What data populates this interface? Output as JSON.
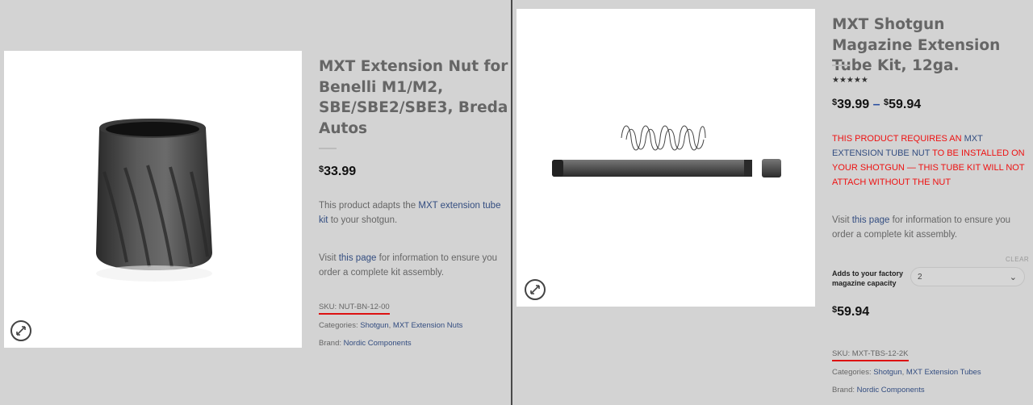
{
  "left_product": {
    "title": "MXT Extension Nut for Benelli M1/M2, SBE/SBE2/SBE3, Breda Autos",
    "price_currency": "$",
    "price_amount": "33.99",
    "desc_prefix": "This product adapts the ",
    "desc_link": "MXT extension tube kit",
    "desc_suffix": " to your shotgun.",
    "visit_prefix": "Visit ",
    "visit_link": "this page",
    "visit_suffix": " for information to ensure you order a complete kit assembly.",
    "sku_label": "SKU: NUT-BN-12-00",
    "categories_label": "Categories: ",
    "categories": [
      "Shotgun",
      "MXT Extension Nuts"
    ],
    "brand_label": "Brand: ",
    "brand": "Nordic Components",
    "image_icon": "zoom-expand-icon"
  },
  "right_product": {
    "title": "MXT Shotgun Magazine Extension Tube Kit, 12ga.",
    "rating": 5,
    "stars_text": "★★★★★",
    "price_low_currency": "$",
    "price_low": "39.99",
    "price_sep": "–",
    "price_high_currency": "$",
    "price_high": "59.94",
    "notice_prefix": "THIS PRODUCT REQUIRES AN ",
    "notice_link": "MXT EXTENSION TUBE NUT",
    "notice_suffix": " TO BE INSTALLED ON YOUR SHOTGUN — THIS TUBE KIT WILL NOT ATTACH WITHOUT THE NUT",
    "visit_prefix": "Visit ",
    "visit_link": "this page",
    "visit_suffix": " for information to ensure you order a complete kit assembly.",
    "clear_label": "CLEAR",
    "variation_label": "Adds to your factory magazine capacity",
    "variation_value": "2",
    "selected_price_currency": "$",
    "selected_price": "59.94",
    "sku_label": "SKU: MXT-TBS-12-2K",
    "categories_label": "Categories: ",
    "categories": [
      "Shotgun",
      "MXT Extension Tubes"
    ],
    "brand_label": "Brand: ",
    "brand": "Nordic Components",
    "image_icon": "zoom-expand-icon"
  },
  "colors": {
    "background": "#d3d3d3",
    "link": "#334d80",
    "notice_red": "#e11111",
    "sku_underline": "#dd1111"
  }
}
